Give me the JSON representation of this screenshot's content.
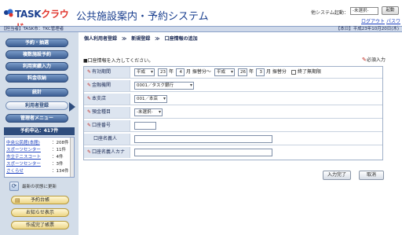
{
  "header": {
    "logo_prefix": "TASK",
    "logo_suffix": "クラウド",
    "app_title": "公共施設案内・予約システム",
    "system_launch_label": "他システム起動：",
    "system_select_value": "-未選択-",
    "launch_button": "起動",
    "logout_link": "ログアウト",
    "password_link": "パスワード変更"
  },
  "infobar": {
    "left_text": "【担当者】TASK市：TKC管理者",
    "right_text": "【本日】平成23年10月20日(木)"
  },
  "sidebar": {
    "menu": [
      "予約・抽選",
      "複数施設予約",
      "利用実績入力",
      "料金収納",
      "統計",
      "利用者登録",
      "管理者メニュー"
    ],
    "active_item": "利用者登録",
    "notice_title": "予約申込：417件",
    "notice_items": [
      {
        "name": "中央公民館(本館)",
        "count": "：208件"
      },
      {
        "name": "スポーツセンター",
        "count": "：11件"
      },
      {
        "name": "市立テニスコート",
        "count": "：4件"
      },
      {
        "name": "スポーツセンター",
        "count": "：3件"
      },
      {
        "name": "さくらせ",
        "count": "：134件"
      }
    ],
    "refresh_label": "最新の状態に更新",
    "bottom_buttons": [
      "予約台帳",
      "お知らせ表示",
      "作成完了帳票"
    ]
  },
  "breadcrumb": "個人利用者登録　≫　新規登録　≫　口座情報の追加",
  "instruction": "■口座情報を入力してください。",
  "required_legend": "必須入力",
  "form": {
    "validity": {
      "label": "有効期間",
      "era_from": "平成",
      "year_from": "23",
      "year_unit_1": "年",
      "month_from": "4",
      "month_suffix_from": "月 振替分～",
      "era_to": "平成",
      "year_to": "26",
      "year_unit_2": "年",
      "month_to": "3",
      "month_suffix_to": "月 振替分",
      "no_end_label": "終了無期限"
    },
    "bank": {
      "label": "金融機関",
      "value": "0001／タスク銀行"
    },
    "branch": {
      "label": "本支店",
      "value": "001／本店"
    },
    "account_type": {
      "label": "預金種目",
      "value": "-未選択-"
    },
    "account_number": {
      "label": "口座番号",
      "value": ""
    },
    "holder_name": {
      "label": "口座名義人",
      "value": ""
    },
    "holder_kana": {
      "label": "口座名義人カナ",
      "value": ""
    }
  },
  "buttons": {
    "confirm": "入力完了",
    "cancel": "取消"
  },
  "colors": {
    "brand_blue": "#1a3f8f",
    "brand_red": "#e0342c",
    "sidebar_bg": "#d3dde9",
    "menu_button": "#3d5f94",
    "required_mark": "#c0281e"
  }
}
